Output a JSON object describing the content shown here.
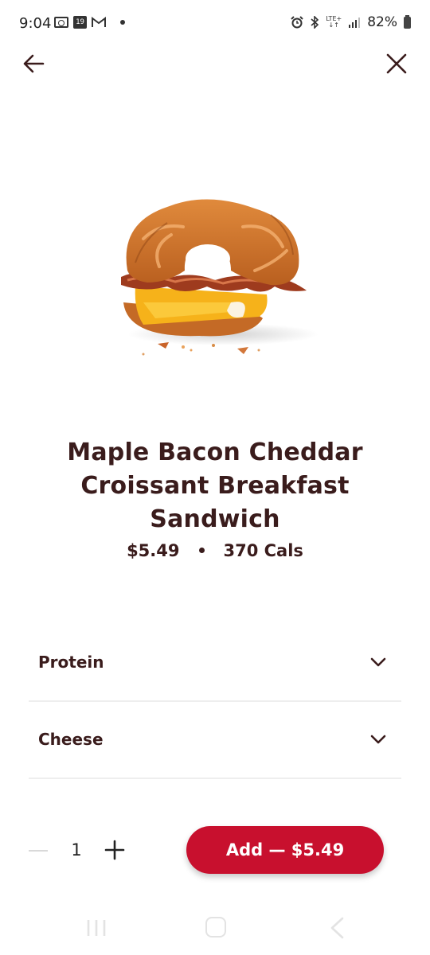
{
  "status_bar": {
    "time": "9:04",
    "calendar_day": "19",
    "battery": "82%",
    "icons": [
      "outlook-icon",
      "calendar-icon",
      "gmail-icon",
      "dot-icon",
      "alarm-icon",
      "bluetooth-icon",
      "lte-icon",
      "signal-icon",
      "battery-icon"
    ],
    "lte_label": "LTE+"
  },
  "nav": {
    "back_icon": "arrow-left-icon",
    "close_icon": "close-icon"
  },
  "product": {
    "image": "croissant-sandwich-image",
    "title": "Maple Bacon Cheddar Croissant Breakfast Sandwich",
    "price": "$5.49",
    "calories": "370 Cals"
  },
  "options": [
    {
      "label": "Protein",
      "icon": "chevron-down-icon"
    },
    {
      "label": "Cheese",
      "icon": "chevron-down-icon"
    }
  ],
  "order": {
    "quantity": "1",
    "add_label": "Add — $5.49",
    "accent": "#c8102e"
  },
  "colors": {
    "text": "#3a1c1c",
    "divider": "#eeeeee",
    "button": "#c8102e"
  }
}
